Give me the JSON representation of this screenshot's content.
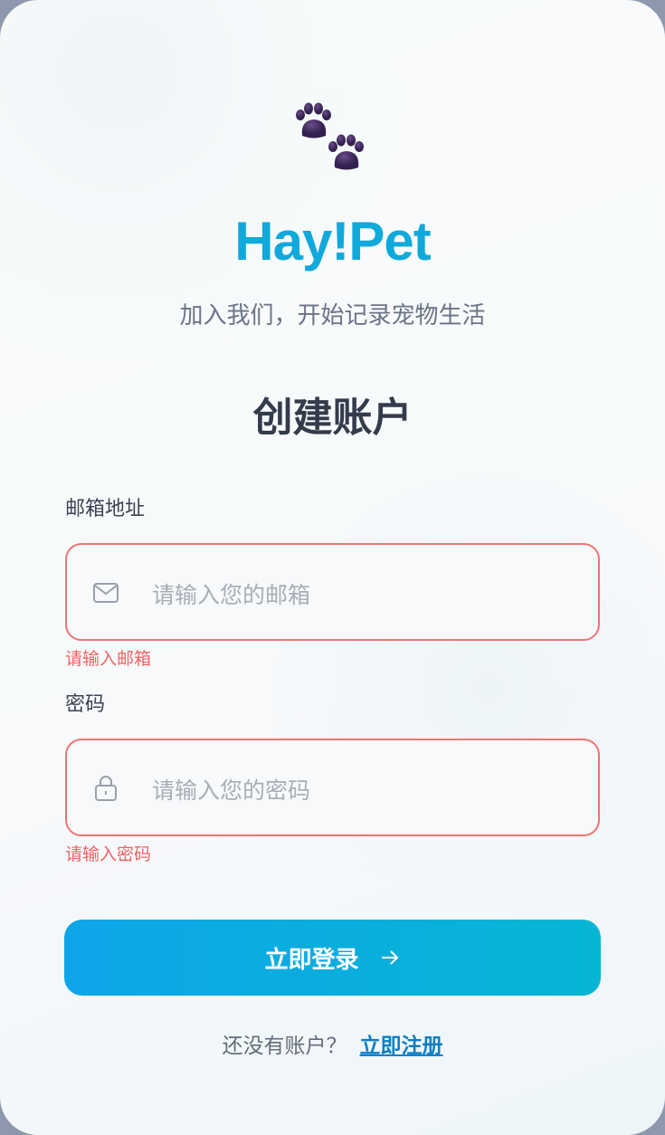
{
  "app": {
    "name": "Hay!Pet",
    "tagline": "加入我们，开始记录宠物生活",
    "logo_icon": "paw-prints-icon"
  },
  "form": {
    "heading": "创建账户",
    "email": {
      "label": "邮箱地址",
      "placeholder": "请输入您的邮箱",
      "value": "",
      "error": "请输入邮箱",
      "icon": "mail-icon"
    },
    "password": {
      "label": "密码",
      "placeholder": "请输入您的密码",
      "value": "",
      "error": "请输入密码",
      "icon": "lock-icon"
    },
    "submit_label": "立即登录",
    "submit_icon": "arrow-right-icon"
  },
  "footer": {
    "prompt": "还没有账户？",
    "link": "立即注册"
  },
  "colors": {
    "brand": "#10a9dc",
    "error": "#f07373",
    "button_start": "#0ea5e9",
    "button_end": "#06b6d4",
    "logo": "#3f2a5a"
  }
}
